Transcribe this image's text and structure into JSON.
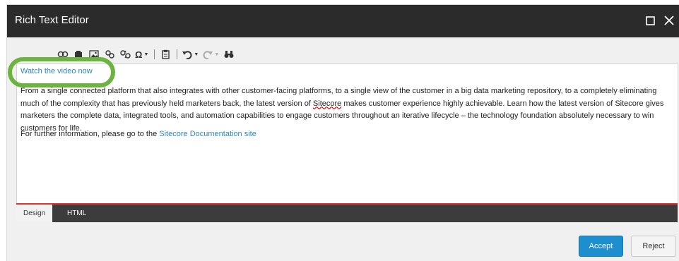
{
  "dialog": {
    "title": "Rich Text Editor",
    "maximize_icon": "maximize-icon",
    "close_icon": "close-icon"
  },
  "toolbar": {
    "icons": [
      "insert-link-icon",
      "insert-image-icon",
      "insert-media-icon",
      "link-icon",
      "unlink-icon",
      "special-characters-icon",
      "paste-icon",
      "undo-icon",
      "redo-icon",
      "find-icon"
    ],
    "special_char_glyph": "Ω"
  },
  "editor": {
    "video_link": "Watch the video now",
    "paragraph1": {
      "before": "From a single connected platform that also integrates with other customer-facing platforms, to a single view of the customer in a big data marketing repository, to a completely eliminating much of the complexity that has previously held marketers back, the latest version of ",
      "brand": "Sitecore",
      "after": " makes customer experience highly achievable. Learn how the latest version of Sitecore gives marketers the complete data, integrated tools, and automation capabilities to engage customers throughout an iterative lifecycle – the technology foundation absolutely necessary to win customers for life."
    },
    "paragraph2": {
      "before": "For further information, please go to the ",
      "link": "Sitecore Documentation site"
    }
  },
  "modes": {
    "design": "Design",
    "html": "HTML"
  },
  "actions": {
    "accept": "Accept",
    "reject": "Reject"
  },
  "colors": {
    "titlebar": "#2b2b2b",
    "accept": "#1d8fcf",
    "link": "#2e86c1",
    "highlight": "#6cb33f",
    "mode_accent": "#dd3333"
  }
}
